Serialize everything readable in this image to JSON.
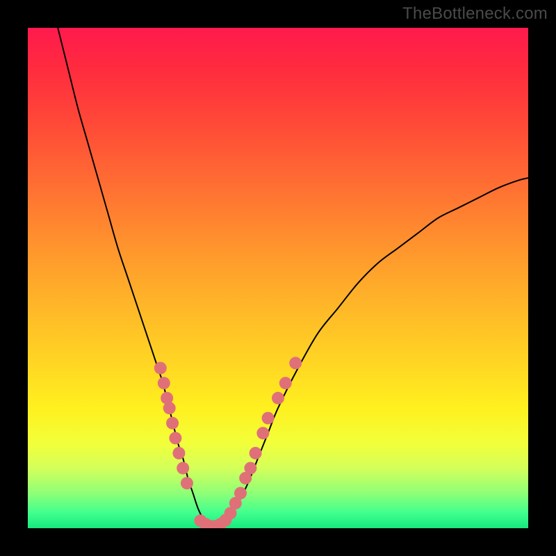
{
  "watermark": "TheBottleneck.com",
  "colors": {
    "background_frame": "#000000",
    "gradient_top": "#ff1a4d",
    "gradient_bottom": "#17e97e",
    "curve": "#000000",
    "dots": "#e07078"
  },
  "chart_data": {
    "type": "line",
    "title": "",
    "xlabel": "",
    "ylabel": "",
    "xlim": [
      0,
      100
    ],
    "ylim": [
      0,
      100
    ],
    "legend": false,
    "grid": false,
    "series": [
      {
        "name": "bottleneck-curve",
        "x": [
          6,
          8,
          10,
          12,
          14,
          16,
          18,
          20,
          22,
          24,
          26,
          27,
          28,
          29,
          30,
          31,
          32,
          33,
          34,
          35,
          36,
          37,
          38,
          40,
          42,
          44,
          46,
          48,
          50,
          54,
          58,
          62,
          66,
          70,
          74,
          78,
          82,
          86,
          90,
          94,
          98,
          100
        ],
        "y": [
          100,
          92,
          84,
          77,
          70,
          63,
          56,
          50,
          44,
          38,
          32,
          29,
          25,
          21,
          17,
          14,
          10,
          7,
          4,
          2,
          0.8,
          0.3,
          0.5,
          2,
          5,
          9,
          14,
          19,
          24,
          32,
          39,
          44,
          49,
          53,
          56,
          59,
          62,
          64,
          66,
          68,
          69.5,
          70
        ]
      }
    ],
    "points": [
      {
        "name": "left-cluster",
        "coords": [
          {
            "x": 26.5,
            "y": 32
          },
          {
            "x": 27.2,
            "y": 29
          },
          {
            "x": 27.8,
            "y": 26
          },
          {
            "x": 28.3,
            "y": 24
          },
          {
            "x": 28.9,
            "y": 21
          },
          {
            "x": 29.5,
            "y": 18
          },
          {
            "x": 30.2,
            "y": 15
          },
          {
            "x": 31.0,
            "y": 12
          },
          {
            "x": 31.8,
            "y": 9
          }
        ]
      },
      {
        "name": "bottom-cluster",
        "coords": [
          {
            "x": 34.5,
            "y": 1.5
          },
          {
            "x": 35.5,
            "y": 0.8
          },
          {
            "x": 36.5,
            "y": 0.4
          },
          {
            "x": 37.5,
            "y": 0.4
          },
          {
            "x": 38.5,
            "y": 0.8
          },
          {
            "x": 39.5,
            "y": 1.6
          }
        ]
      },
      {
        "name": "right-cluster",
        "coords": [
          {
            "x": 40.5,
            "y": 3
          },
          {
            "x": 41.5,
            "y": 5
          },
          {
            "x": 42.5,
            "y": 7
          },
          {
            "x": 43.5,
            "y": 10
          },
          {
            "x": 44.5,
            "y": 12
          },
          {
            "x": 45.5,
            "y": 15
          },
          {
            "x": 47.0,
            "y": 19
          },
          {
            "x": 48.0,
            "y": 22
          },
          {
            "x": 50.0,
            "y": 26
          },
          {
            "x": 51.5,
            "y": 29
          },
          {
            "x": 53.5,
            "y": 33
          }
        ]
      }
    ]
  }
}
